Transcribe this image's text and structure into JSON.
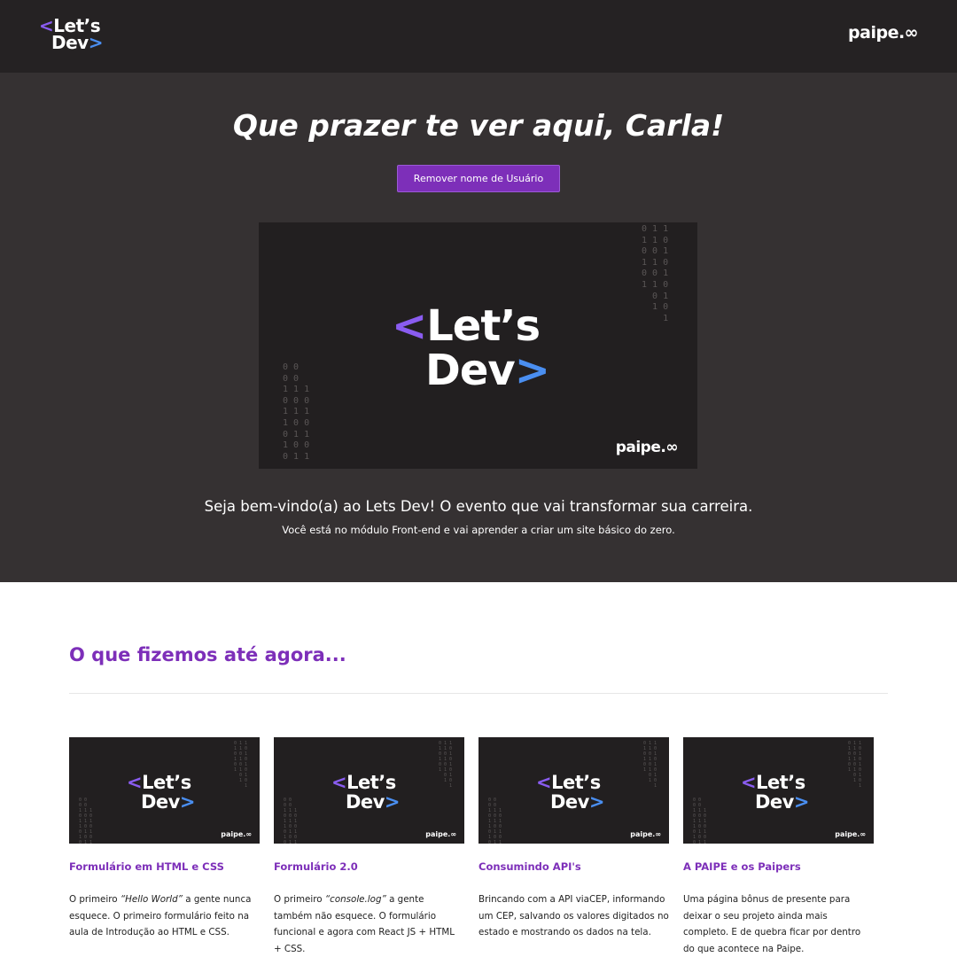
{
  "header": {
    "logo_line1_prefix": "<",
    "logo_line1_text": "Let’s",
    "logo_line2_text": "Dev",
    "logo_line2_suffix": ">",
    "partner_logo": "paipe.∞"
  },
  "hero": {
    "title": "Que prazer te ver aqui, Carla!",
    "remove_button_label": "Remover nome de Usuário",
    "banner_partner_logo": "paipe.∞",
    "binary_right": "0 1 1\n1 1 0\n0 0 1\n1 1 0\n0 0 1\n1 1 0\n  0 1\n  1 0\n    1",
    "binary_left": "0 0\n0 0\n1 1 1\n0 0 0\n1 1 1\n1 0 0\n0 1 1\n1 0 0\n0 1 1",
    "welcome_text": "Seja bem-vindo(a) ao Lets Dev! O evento que vai transformar sua carreira.",
    "module_text": "Você está no módulo Front-end e vai aprender a criar um site básico do zero."
  },
  "projects": {
    "section_title": "O que fizemos até agora...",
    "cards": [
      {
        "title": "Formulário em HTML e CSS",
        "text_before": "O primeiro ",
        "text_em": "“Hello World”",
        "text_after": " a gente nunca esquece. O primeiro formulário feito na aula de Introdução ao HTML e CSS."
      },
      {
        "title": "Formulário 2.0",
        "text_before": "O primeiro ",
        "text_em": "“console.log”",
        "text_after": " a gente também não esquece. O formulário funcional e agora com React JS + HTML + CSS."
      },
      {
        "title": "Consumindo API's",
        "text_before": "Brincando com a API viaCEP, informando um CEP, salvando os valores digitados no estado e mostrando os dados na tela.",
        "text_em": "",
        "text_after": ""
      },
      {
        "title": "A PAIPE e os Paipers",
        "text_before": "Uma página bônus de presente para deixar o seu projeto ainda mais completo. E de quebra ficar por dentro do que acontece na Paipe.",
        "text_em": "",
        "text_after": ""
      }
    ]
  },
  "colors": {
    "accent": "#7d2fb9",
    "topbar": "#252223",
    "hero_bg": "#353132",
    "banner_bg": "#221f20",
    "chevron_left": "#8a5cf0",
    "chevron_right": "#4a8ef0"
  },
  "icons": {
    "brand": "lets-dev-logo",
    "partner": "paipe-logo"
  }
}
